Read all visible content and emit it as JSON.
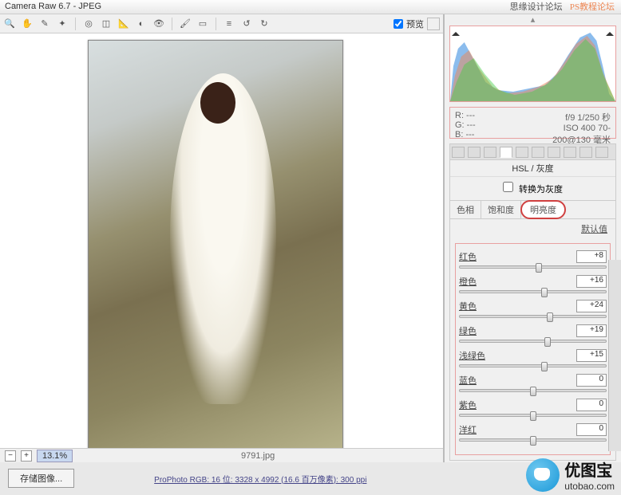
{
  "title": "Camera Raw 6.7  -  JPEG",
  "watermark": {
    "cn": "思缘设计论坛",
    "ps": "PS教程论坛"
  },
  "preview": {
    "label": "预览"
  },
  "zoom": "13.1%",
  "filename": "9791.jpg",
  "info": {
    "r": "R:  ---",
    "g": "G:  ---",
    "b": "B:  ---",
    "exp": "f/9  1/250 秒",
    "iso": "ISO 400   70-200@130 毫米"
  },
  "panel_title": "HSL / 灰度",
  "gray_label": "转换为灰度",
  "subtabs": [
    "色相",
    "饱和度",
    "明亮度"
  ],
  "default_label": "默认值",
  "sliders": [
    {
      "label": "红色",
      "value": "+8",
      "pos": 54
    },
    {
      "label": "橙色",
      "value": "+16",
      "pos": 58
    },
    {
      "label": "黄色",
      "value": "+24",
      "pos": 62
    },
    {
      "label": "绿色",
      "value": "+19",
      "pos": 60
    },
    {
      "label": "浅绿色",
      "value": "+15",
      "pos": 58
    },
    {
      "label": "蓝色",
      "value": "0",
      "pos": 50
    },
    {
      "label": "紫色",
      "value": "0",
      "pos": 50
    },
    {
      "label": "洋红",
      "value": "0",
      "pos": 50
    }
  ],
  "save_btn": "存储图像...",
  "meta_line": "ProPhoto RGB: 16 位: 3328 x 4992 (16.6 百万像素): 300 ppi",
  "utobao": {
    "cn": "优图宝",
    "en": "utobao.com"
  }
}
